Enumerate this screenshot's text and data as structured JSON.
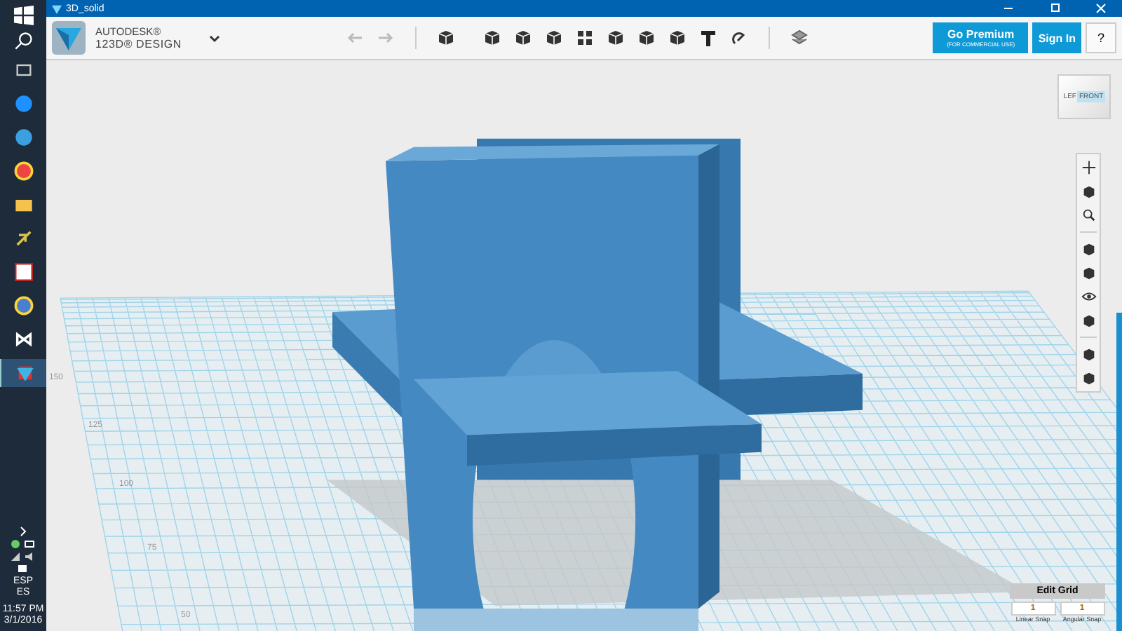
{
  "window": {
    "title": "3D_solid"
  },
  "taskbar": {
    "apps": [
      {
        "selected": false
      },
      {
        "selected": false
      },
      {
        "selected": false
      },
      {
        "selected": false
      },
      {
        "selected": false
      },
      {
        "selected": false
      },
      {
        "selected": false
      },
      {
        "selected": false
      },
      {
        "selected": false
      },
      {
        "selected": true
      }
    ],
    "tray": {
      "language": "ESP",
      "layout": "ES",
      "time": "11:57 PM",
      "date": "3/1/2016"
    }
  },
  "header": {
    "brand": "AUTODESK®",
    "product": "123D® DESIGN",
    "premium": {
      "label": "Go Premium",
      "note": "(FOR COMMERCIAL USE)"
    },
    "sign_in": "Sign In",
    "help": "?"
  },
  "view_cube": {
    "left": "LEF",
    "front": "FRONT"
  },
  "grid_labels": [
    "150",
    "125",
    "100",
    "75",
    "50"
  ],
  "edit_grid": {
    "title": "Edit Grid",
    "linear": {
      "value": "1",
      "label": "Linear Snap"
    },
    "angular": {
      "value": "1",
      "label": "Angular Snap"
    }
  }
}
